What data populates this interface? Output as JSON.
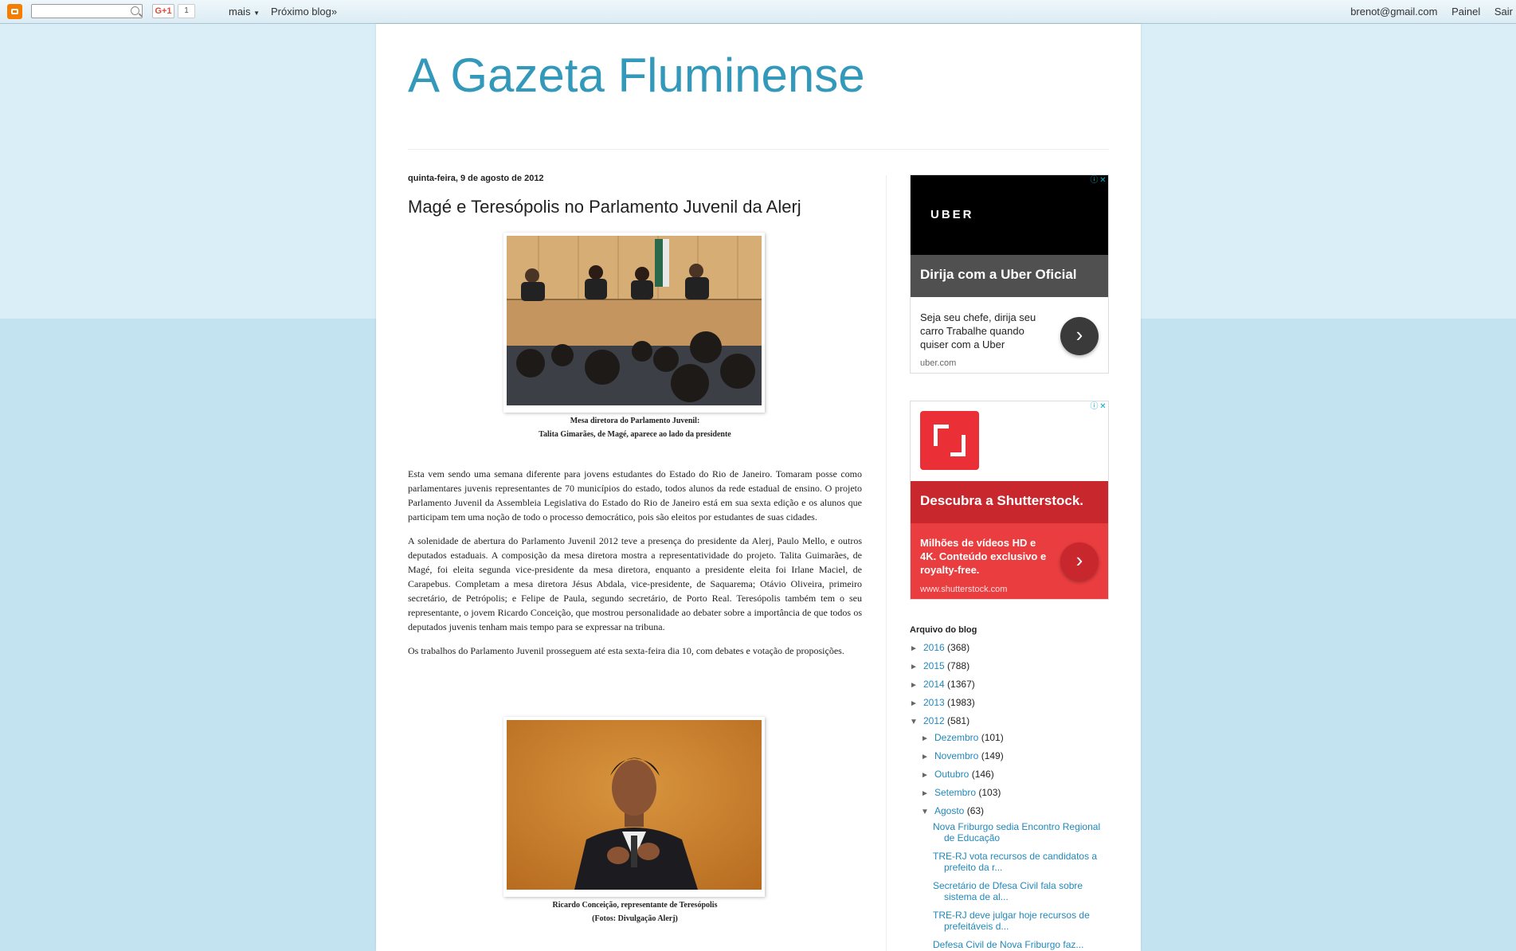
{
  "navbar": {
    "gplus_label": "G+1",
    "gplus_count": "1",
    "more_label": "mais",
    "next_blog_label": "Próximo blog»",
    "user_email": "brenot@gmail.com",
    "dashboard_label": "Painel",
    "signout_label": "Sair"
  },
  "blog": {
    "title": "A Gazeta Fluminense"
  },
  "post": {
    "date": "quinta-feira, 9 de agosto de 2012",
    "title": "Magé e Teresópolis no Parlamento Juvenil da Alerj",
    "photo1_caption": [
      "Mesa diretora do Parlamento Juvenil:",
      "Talita Gimarães, de Magé, aparece ao lado da presidente"
    ],
    "paragraphs": [
      "Esta vem sendo uma semana diferente para jovens estudantes do Estado do Rio de Janeiro.  Tomaram posse como parlamentares juvenis representantes de 70 municípios do estado, todos alunos da rede estadual de ensino.  O projeto Parlamento Juvenil da Assembleia Legislativa do Estado do Rio de Janeiro está em sua sexta edição e os alunos que participam tem uma noção de todo o processo democrático, pois são eleitos por estudantes de suas cidades.",
      "A solenidade de abertura do Parlamento Juvenil 2012 teve a presença do presidente da Alerj, Paulo Mello, e outros deputados estaduais. A composição da mesa diretora mostra a representatividade do projeto. Talita Guimarães, de Magé, foi eleita segunda vice-presidente da mesa diretora, enquanto a presidente eleita foi Irlane Maciel, de Carapebus. Completam a mesa diretora Jésus Abdala, vice-presidente, de Saquarema; Otávio Oliveira, primeiro secretário, de Petrópolis; e Felipe de Paula, segundo secretário, de Porto Real. Teresópolis também tem o seu representante, o jovem Ricardo Conceição, que mostrou personalidade ao debater sobre a importância de que todos os deputados juvenis tenham mais tempo para se expressar na tribuna.",
      "Os trabalhos do Parlamento Juvenil prosseguem até esta sexta-feira dia 10, com debates e votação de proposições."
    ],
    "photo2_caption": [
      "Ricardo Conceição, representante de Teresópolis",
      "(Fotos: Divulgação Alerj)"
    ]
  },
  "ads": {
    "uber": {
      "logo": "UBER",
      "headline": "Dirija com a Uber Oficial",
      "description": "Seja seu chefe, dirija seu carro Trabalhe quando quiser com a Uber",
      "url": "uber.com",
      "color_band": "#505050"
    },
    "shutterstock": {
      "headline": "Descubra a Shutterstock.",
      "description": "Milhões de vídeos HD e 4K. Conteúdo exclusivo e royalty-free.",
      "url": "www.shutterstock.com",
      "color_brand": "#ea2f36"
    }
  },
  "archive": {
    "title": "Arquivo do blog",
    "years": [
      {
        "toggle": "►",
        "label": "2016",
        "count": "(368)"
      },
      {
        "toggle": "►",
        "label": "2015",
        "count": "(788)"
      },
      {
        "toggle": "►",
        "label": "2014",
        "count": "(1367)"
      },
      {
        "toggle": "►",
        "label": "2013",
        "count": "(1983)"
      },
      {
        "toggle": "▼",
        "label": "2012",
        "count": "(581)"
      }
    ],
    "months": [
      {
        "toggle": "►",
        "label": "Dezembro",
        "count": "(101)"
      },
      {
        "toggle": "►",
        "label": "Novembro",
        "count": "(149)"
      },
      {
        "toggle": "►",
        "label": "Outubro",
        "count": "(146)"
      },
      {
        "toggle": "►",
        "label": "Setembro",
        "count": "(103)"
      },
      {
        "toggle": "▼",
        "label": "Agosto",
        "count": "(63)"
      }
    ],
    "posts": [
      "Nova Friburgo sedia Encontro Regional de Educação",
      "TRE-RJ vota recursos de candidatos a prefeito da r...",
      "Secretário de Dfesa Civil fala sobre sistema de al...",
      "TRE-RJ deve julgar hoje recursos de prefeitáveis d...",
      "Defesa Civil de Nova Friburgo faz..."
    ]
  },
  "colors": {
    "title_blue": "#3399bb",
    "link_blue": "#2288bb",
    "background": "#c3e3f1"
  }
}
